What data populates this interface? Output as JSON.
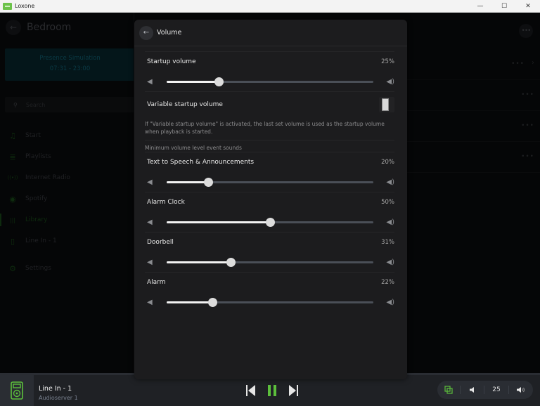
{
  "window": {
    "title": "Loxone",
    "controls": {
      "minimize": "—",
      "maximize": "☐",
      "close": "✕"
    }
  },
  "page": {
    "title": "Bedroom",
    "back_icon": "←",
    "more_icon": "•••"
  },
  "presence": {
    "title": "Presence Simulation",
    "time": "07:31 - 23:00"
  },
  "search": {
    "placeholder": "Search",
    "icon": "⚲"
  },
  "sidebar": {
    "items": [
      {
        "label": "Start",
        "icon": "♫"
      },
      {
        "label": "Playlists",
        "icon": "≣"
      },
      {
        "label": "Internet Radio",
        "icon": "((•))"
      },
      {
        "label": "Spotify",
        "icon": "◉"
      },
      {
        "label": "Library",
        "icon": "|||",
        "active": true
      },
      {
        "label": "Line In - 1",
        "icon": "▯"
      },
      {
        "label": "Settings",
        "icon": "⚙"
      }
    ]
  },
  "right_rows": [
    {
      "more": "•••",
      "chevron": "›"
    },
    {
      "more": "•••"
    },
    {
      "more": "•••"
    },
    {
      "more": "•••"
    }
  ],
  "modal": {
    "title": "Volume",
    "back_icon": "←",
    "startup": {
      "label": "Startup volume",
      "value": 25,
      "display": "25%"
    },
    "variable_startup": {
      "label": "Variable startup volume",
      "enabled": false,
      "info": "If \"Variable startup volume\" is activated, the last set volume is used as the startup volume when playback is started."
    },
    "section_label": "Minimum volume level event sounds",
    "events": [
      {
        "label": "Text to Speech & Announcements",
        "value": 20,
        "display": "20%"
      },
      {
        "label": "Alarm Clock",
        "value": 50,
        "display": "50%"
      },
      {
        "label": "Doorbell",
        "value": 31,
        "display": "31%"
      },
      {
        "label": "Alarm",
        "value": 22,
        "display": "22%"
      }
    ],
    "speaker_low_icon": "🔈",
    "speaker_high_icon": "🔊"
  },
  "now_playing": {
    "title": "Line In - 1",
    "subtitle": "Audioserver 1",
    "volume": "25",
    "state": "playing"
  },
  "colors": {
    "accent": "#5cbf3c",
    "modal_bg": "#1c1c1e",
    "bottom_bar": "#1f2125"
  }
}
